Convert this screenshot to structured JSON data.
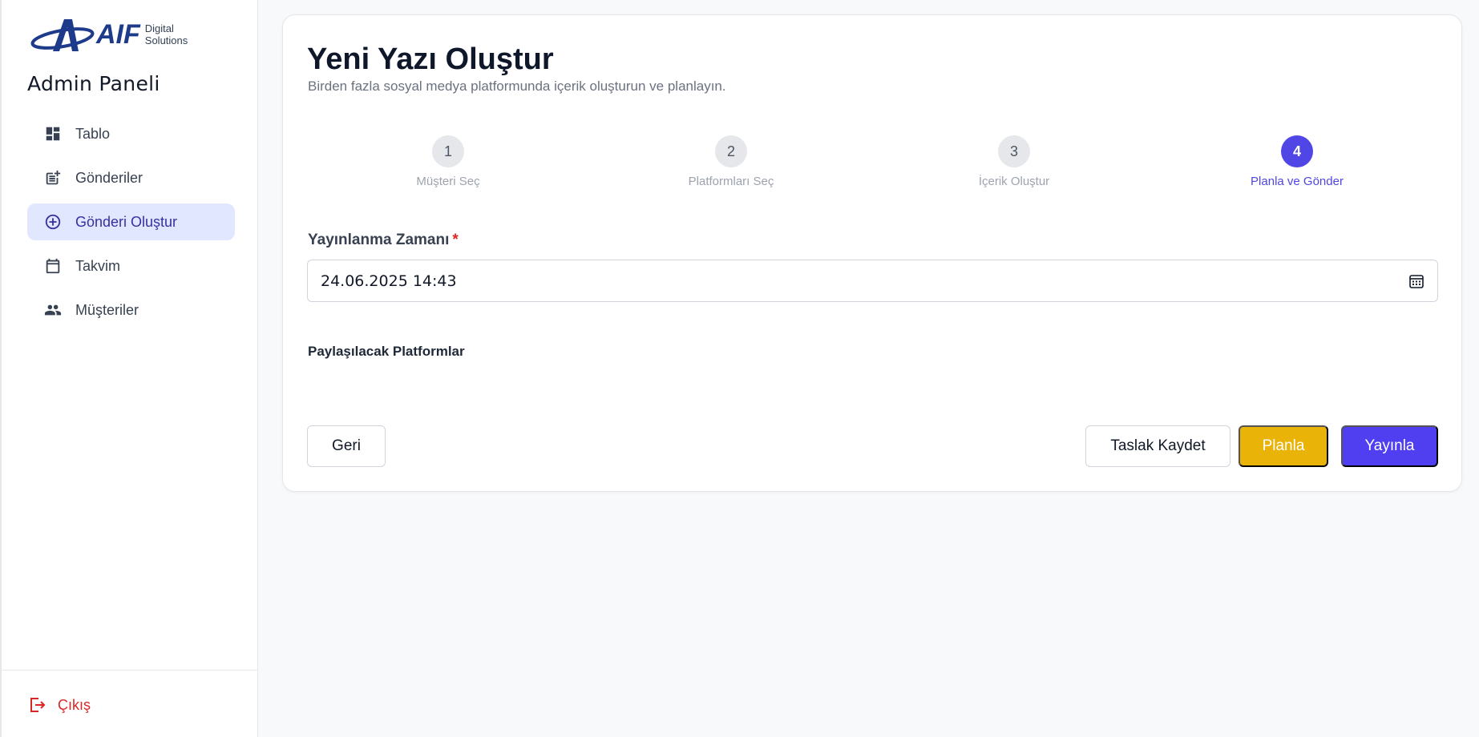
{
  "brand": {
    "logo_text": "AIF",
    "logo_sub_1": "Digital",
    "logo_sub_2": "Solutions",
    "panel_title": "Admin Paneli"
  },
  "sidebar": {
    "items": [
      {
        "label": "Tablo",
        "icon": "dashboard-icon"
      },
      {
        "label": "Gönderiler",
        "icon": "post-add-icon"
      },
      {
        "label": "Gönderi Oluştur",
        "icon": "plus-circle-icon",
        "active": true
      },
      {
        "label": "Takvim",
        "icon": "calendar-icon"
      },
      {
        "label": "Müşteriler",
        "icon": "people-icon"
      }
    ],
    "logout_label": "Çıkış"
  },
  "main": {
    "title": "Yeni Yazı Oluştur",
    "subtitle": "Birden fazla sosyal medya platformunda içerik oluşturun ve planlayın.",
    "steps": [
      {
        "num": "1",
        "label": "Müşteri Seç"
      },
      {
        "num": "2",
        "label": "Platformları Seç"
      },
      {
        "num": "3",
        "label": "İçerik Oluştur"
      },
      {
        "num": "4",
        "label": "Planla ve Gönder",
        "active": true
      }
    ],
    "publish_time_label": "Yayınlanma Zamanı",
    "required_mark": "*",
    "publish_time_value": "24.06.2025  14:43",
    "platforms_label": "Paylaşılacak Platformlar",
    "buttons": {
      "back": "Geri",
      "draft": "Taslak Kaydet",
      "schedule": "Planla",
      "publish": "Yayınla"
    }
  },
  "colors": {
    "accent": "#4f46e5",
    "schedule": "#eab308",
    "danger": "#dc2626",
    "active_bg": "#e0e7ff"
  }
}
